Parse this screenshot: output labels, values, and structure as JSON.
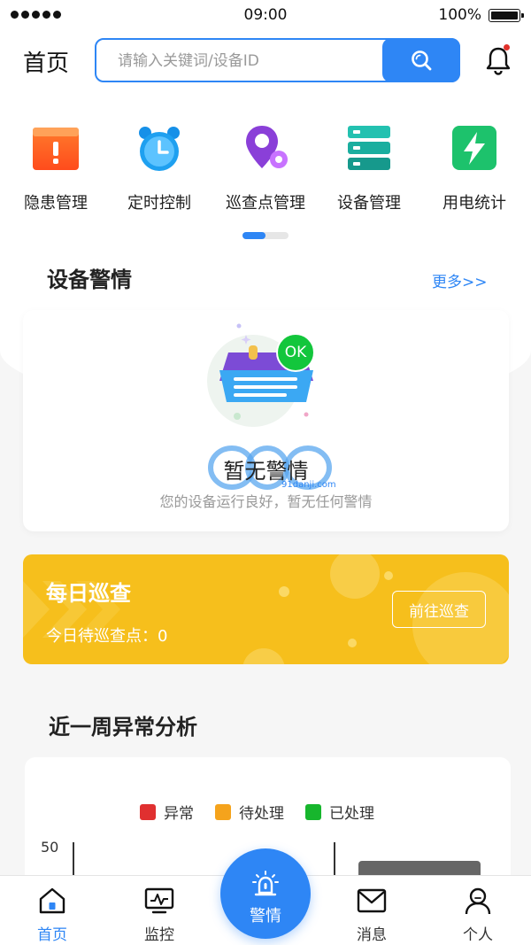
{
  "status_bar": {
    "time": "09:00",
    "battery": "100%"
  },
  "header": {
    "title": "首页",
    "search_placeholder": "请输入关键词/设备ID"
  },
  "menu": [
    {
      "label": "隐患管理",
      "icon": "warning-icon"
    },
    {
      "label": "定时控制",
      "icon": "alarm-clock-icon"
    },
    {
      "label": "巡查点管理",
      "icon": "location-pin-icon"
    },
    {
      "label": "设备管理",
      "icon": "server-icon"
    },
    {
      "label": "用电统计",
      "icon": "lightning-icon"
    }
  ],
  "alarm": {
    "title": "设备警情",
    "more": "更多>>",
    "badge": "OK",
    "empty_title": "暂无警情",
    "empty_desc": "您的设备运行良好，暂无任何警情",
    "watermark": "91danji.com"
  },
  "patrol": {
    "title": "每日巡查",
    "count_label": "今日待巡查点：0",
    "button": "前往巡查"
  },
  "weekly": {
    "title": "近一周异常分析",
    "legend": [
      {
        "label": "异常",
        "color": "#e03030"
      },
      {
        "label": "待处理",
        "color": "#f5a31c"
      },
      {
        "label": "已处理",
        "color": "#17b62d"
      }
    ],
    "ytick_top": "50"
  },
  "tabbar": [
    {
      "label": "首页",
      "icon": "home-icon",
      "active": true
    },
    {
      "label": "监控",
      "icon": "monitor-icon",
      "active": false
    },
    {
      "label": "警情",
      "icon": "siren-icon",
      "active": false
    },
    {
      "label": "消息",
      "icon": "mail-icon",
      "active": false
    },
    {
      "label": "个人",
      "icon": "user-icon",
      "active": false
    }
  ],
  "colors": {
    "primary": "#2e86f5",
    "patrol": "#f6bf1c",
    "badge_dot": "#e0312b"
  }
}
